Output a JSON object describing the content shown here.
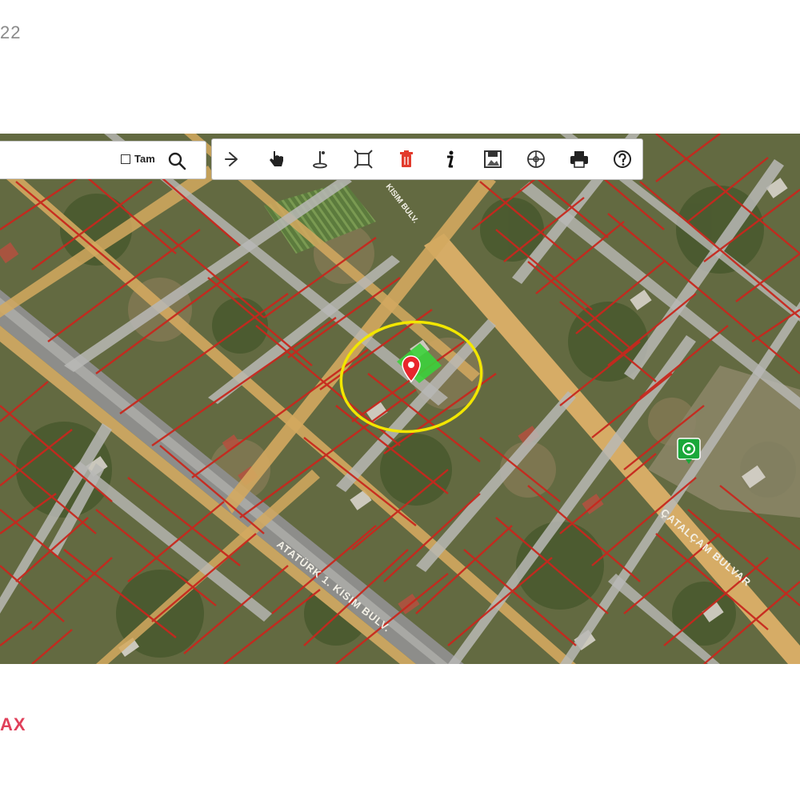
{
  "page": {
    "top_corner_text": "22",
    "bottom_corner_text": "AX"
  },
  "search": {
    "checkbox_label": "Tam",
    "checkbox_checked": false,
    "icon": "search-icon"
  },
  "toolbar": {
    "tools": [
      {
        "id": "arrow",
        "icon": "arrow-right-icon"
      },
      {
        "id": "pan",
        "icon": "hand-pointer-icon"
      },
      {
        "id": "info-point",
        "icon": "info-pin-icon"
      },
      {
        "id": "extent",
        "icon": "full-extent-icon"
      },
      {
        "id": "delete",
        "icon": "trash-icon"
      },
      {
        "id": "info",
        "icon": "info-icon"
      },
      {
        "id": "save",
        "icon": "save-image-icon"
      },
      {
        "id": "coordinate",
        "icon": "coordinate-icon"
      },
      {
        "id": "print",
        "icon": "printer-icon"
      },
      {
        "id": "help",
        "icon": "help-icon"
      }
    ]
  },
  "map": {
    "street_labels": [
      "ATATÜRK 1. KISIM BULV.",
      "ÇATALÇAM BULVAR",
      "KISIM BULV."
    ],
    "highlight_color": "#f2e600",
    "marker_color": "#e8252d",
    "parcel_fill": "#3bd23b",
    "parcel_line_color": "#c8281e",
    "poi_icon": "green-poi-icon"
  }
}
